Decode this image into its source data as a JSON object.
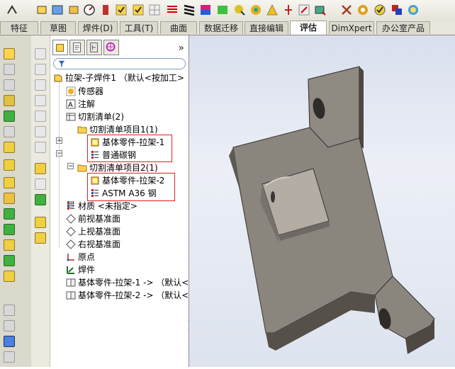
{
  "toolbar": {
    "icons": [
      "sketch-icon",
      "smart-dimension-icon",
      "relations-icon",
      "rebuild-icon",
      "measure-icon",
      "checkbox-icon",
      "checkbox-icon",
      "grid-icon",
      "zebra-icon",
      "curvature-icon",
      "check-icon",
      "draft-analysis-icon",
      "undercut-icon",
      "parting-icon",
      "thickness-icon",
      "symmetry-icon",
      "compare-icon",
      "sensor-icon",
      "evaluate-icon",
      "mass-icon",
      "ok-icon",
      "color-icon",
      "appearance-icon"
    ]
  },
  "tabs": [
    {
      "label": "特征"
    },
    {
      "label": "草图"
    },
    {
      "label": "焊件(D)"
    },
    {
      "label": "工具(T)"
    },
    {
      "label": "曲面"
    },
    {
      "label": "数据迁移"
    },
    {
      "label": "直接编辑"
    },
    {
      "label": "评估"
    },
    {
      "label": "DimXpert"
    },
    {
      "label": "办公室产品"
    }
  ],
  "featuremanager": {
    "tree": [
      {
        "label": "拉架-子焊件1  （默认<按加工>"
      },
      {
        "label": "传感器"
      },
      {
        "label": "注解"
      },
      {
        "label": "切割清单(2)"
      },
      {
        "label": "切割清单项目1(1)"
      },
      {
        "label": "基体零件-拉架-1"
      },
      {
        "label": "普通碳钢"
      },
      {
        "label": "切割清单项目2(1)"
      },
      {
        "label": "基体零件-拉架-2"
      },
      {
        "label": "ASTM A36 钢"
      },
      {
        "label": "材质 <未指定>"
      },
      {
        "label": "前视基准面"
      },
      {
        "label": "上视基准面"
      },
      {
        "label": "右视基准面"
      },
      {
        "label": "原点"
      },
      {
        "label": "焊件"
      },
      {
        "label": "基体零件-拉架-1 -> （默认<"
      },
      {
        "label": "基体零件-拉架-2 -> （默认<"
      }
    ]
  },
  "colors": {
    "highlight": "#e02020",
    "part_face": "#8f8a82",
    "part_side": "#5f5a54"
  }
}
